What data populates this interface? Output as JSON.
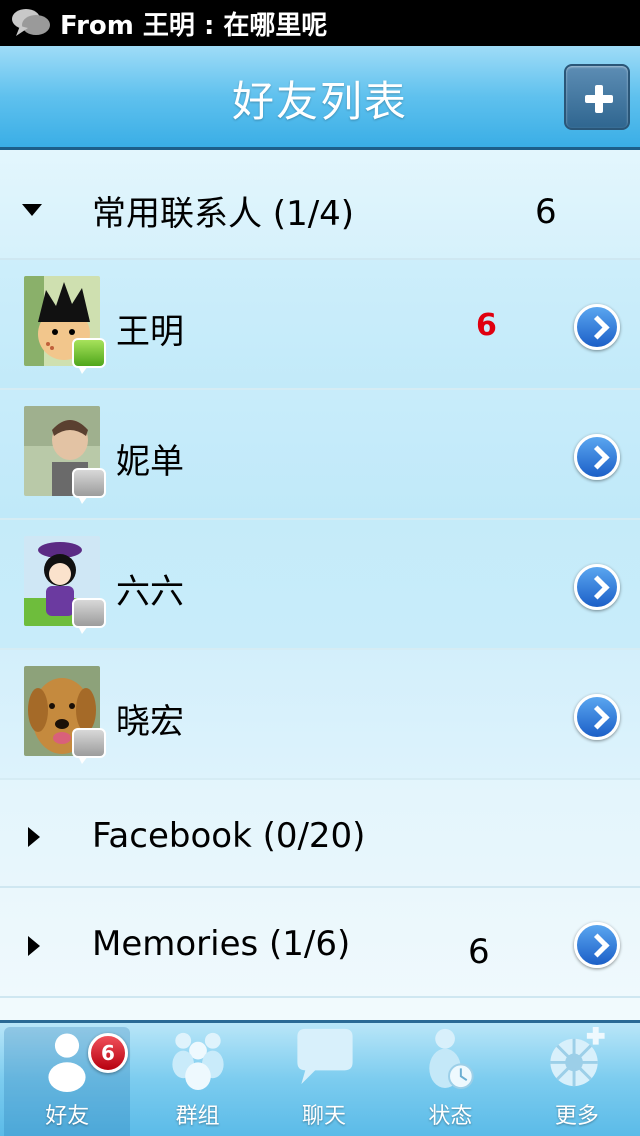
{
  "status_bar": {
    "icon": "chat-bubbles-icon",
    "notification": "From 王明 : 在哪里呢"
  },
  "nav": {
    "title": "好友列表",
    "add_icon": "plus-icon"
  },
  "groups": [
    {
      "label": "常用联系人 (1/4)",
      "count": "6",
      "expanded": true
    },
    {
      "label": "Facebook (0/20)",
      "count": "",
      "expanded": false
    },
    {
      "label": "Memories (1/6)",
      "count": "6",
      "expanded": false
    }
  ],
  "friends": [
    {
      "name": "王明",
      "unread": "6",
      "status": "online",
      "avatar": "cartoon-boy-avatar"
    },
    {
      "name": "妮单",
      "unread": "",
      "status": "offline",
      "avatar": "photo-person-avatar"
    },
    {
      "name": "六六",
      "unread": "",
      "status": "offline",
      "avatar": "cartoon-girl-avatar"
    },
    {
      "name": "晓宏",
      "unread": "",
      "status": "offline",
      "avatar": "dog-photo-avatar"
    }
  ],
  "tabs": [
    {
      "label": "好友",
      "icon": "person-icon",
      "badge": "6",
      "active": true
    },
    {
      "label": "群组",
      "icon": "group-icon",
      "badge": "",
      "active": false
    },
    {
      "label": "聊天",
      "icon": "chat-bubble-icon",
      "badge": "",
      "active": false
    },
    {
      "label": "状态",
      "icon": "status-person-clock-icon",
      "badge": "",
      "active": false
    },
    {
      "label": "更多",
      "icon": "more-wheel-icon",
      "badge": "",
      "active": false
    }
  ],
  "colors": {
    "accent": "#3aaee6",
    "unread": "#e0000f",
    "detail_button": "#1c5fc7"
  }
}
